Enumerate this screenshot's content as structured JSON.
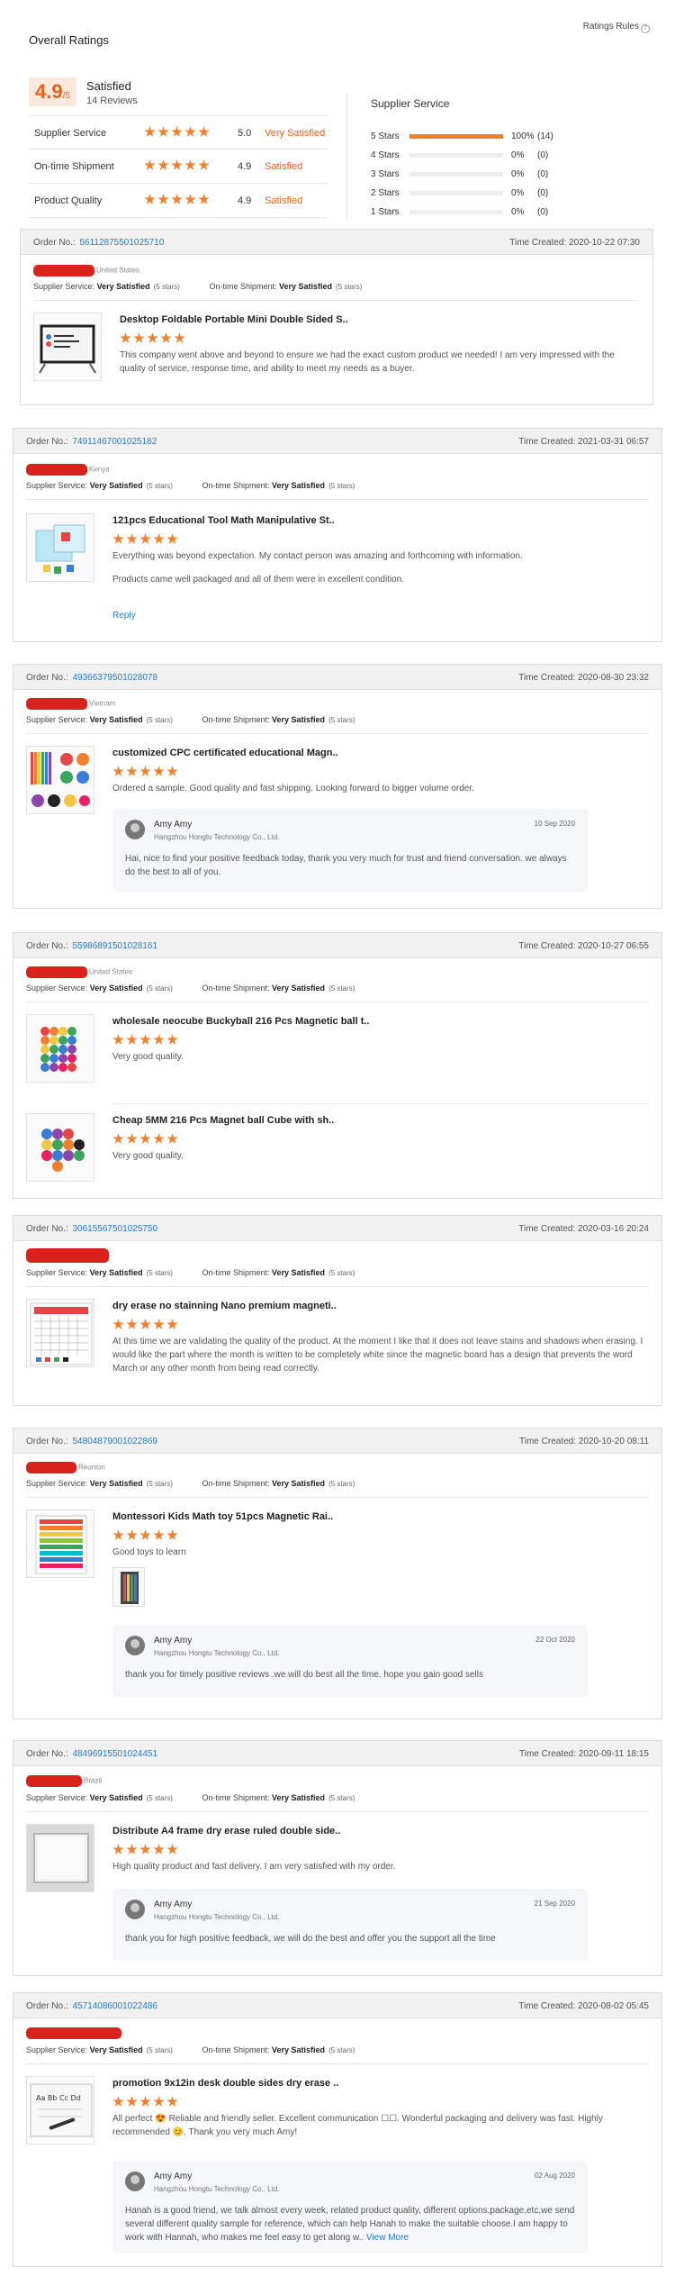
{
  "overall": {
    "title": "Overall Ratings",
    "rules": "Ratings Rules",
    "score_value": "4.9",
    "score_suffix": "/5",
    "score_label": "Satisfied",
    "reviews": "14 Reviews",
    "dimensions": [
      {
        "name": "Supplier Service",
        "value": "5.0",
        "label": "Very Satisfied"
      },
      {
        "name": "On-time Shipment",
        "value": "4.9",
        "label": "Satisfied"
      },
      {
        "name": "Product Quality",
        "value": "4.9",
        "label": "Satisfied"
      }
    ],
    "service_title": "Supplier Service",
    "distribution": [
      {
        "label": "5 Stars",
        "fraction": 1.0,
        "pct": "100%",
        "count": "(14)"
      },
      {
        "label": "4 Stars",
        "fraction": 0,
        "pct": "0%",
        "count": "(0)"
      },
      {
        "label": "3 Stars",
        "fraction": 0,
        "pct": "0%",
        "count": "(0)"
      },
      {
        "label": "2 Stars",
        "fraction": 0,
        "pct": "0%",
        "count": "(0)"
      },
      {
        "label": "1 Stars",
        "fraction": 0,
        "pct": "0%",
        "count": "(0)"
      }
    ]
  },
  "labels": {
    "order_no": "Order No.:",
    "time_created": "Time Created:",
    "supplier_service": "Supplier Service:",
    "ontime_shipment": "On-time Shipment:",
    "very_satisfied": "Very Satisfied",
    "five_stars": "(5 stars)",
    "reply": "Reply",
    "view_more": "View More"
  },
  "reviews": [
    {
      "order_no": "56112875501025710",
      "time": "2020-10-22 07:30",
      "country": "United States",
      "products": [
        {
          "title": "Desktop Foldable Portable Mini Double Sided S..",
          "text": "This company went above and beyond to ensure we had the exact custom product we needed! I am very impressed with the quality of service, response time, and ability to meet my needs as a buyer."
        }
      ]
    },
    {
      "order_no": "74911467001025182",
      "time": "2021-03-31 06:57",
      "country": "Kenya",
      "products": [
        {
          "title": "121pcs Educational Tool Math Manipulative St..",
          "text": "Everything was beyond expectation. My contact person was amazing and forthcoming with information.",
          "text2": "Products came well packaged and all of them were in excellent condition."
        }
      ]
    },
    {
      "order_no": "49366379501028078",
      "time": "2020-08-30 23:32",
      "country": "Vietnam",
      "products": [
        {
          "title": "customized CPC certificated educational Magn..",
          "text": "Ordered a sample. Good quality and fast shipping. Looking forward to bigger volume order."
        }
      ],
      "reply": {
        "name": "Amy Amy",
        "company": "Hangzhou Hongtu Technology Co., Ltd.",
        "date": "10 Sep 2020",
        "text": "Hai, nice to find your positive feedback today, thank you very much  for trust and friend conversation. we always do the best to all of you."
      }
    },
    {
      "order_no": "55986891501028161",
      "time": "2020-10-27 06:55",
      "country": "United States",
      "products": [
        {
          "title": "wholesale neocube Buckyball 216 Pcs Magnetic ball t..",
          "text": "Very good quality."
        },
        {
          "title": "Cheap 5MM 216 Pcs Magnet ball Cube with sh..",
          "text": "Very good quality."
        }
      ]
    },
    {
      "order_no": "30615567501025750",
      "time": "2020-03-16 20:24",
      "country": "",
      "products": [
        {
          "title": "dry erase no stainning Nano premium magneti..",
          "text": "At this time we are validating the quality of the product. At the moment I like that it does not leave stains and shadows when erasing. I would like the part where the month is written to be completely white since the magnetic board has a design that prevents the word March or any other month from being read correctly."
        }
      ]
    },
    {
      "order_no": "54804879001022869",
      "time": "2020-10-20 08:11",
      "country": "Reunion",
      "products": [
        {
          "title": "Montessori Kids Math toy 51pcs Magnetic Rai..",
          "text": "Good toys to learn"
        }
      ],
      "reply": {
        "name": "Amy Amy",
        "company": "Hangzhou Hongtu Technology Co., Ltd.",
        "date": "22 Oct 2020",
        "text": "thank you for timely positive reviews .we will do best all the time. hope you gain good sells"
      }
    },
    {
      "order_no": "48496915501024451",
      "time": "2020-09-11 18:15",
      "country": "Brazil",
      "products": [
        {
          "title": "Distribute A4 frame dry erase ruled double side..",
          "text": "High quality product and fast delivery. I am very satisfied with my order."
        }
      ],
      "reply": {
        "name": "Amy Amy",
        "company": "Hangzhou Hongtu Technology Co., Ltd.",
        "date": "21 Sep 2020",
        "text": "thank you for high positive feedback, we will do the best and offer you the support all the time"
      }
    },
    {
      "order_no": "45714086001022486",
      "time": "2020-08-02 05:45",
      "country": "",
      "products": [
        {
          "title": "promotion 9x12in desk double sides dry erase ..",
          "text": "All perfect 😍 Reliable and friendly seller. Excellent communication ☐☐. Wonderful packaging and delivery was fast. Highly recommended 😊. Thank you very much Amy!"
        }
      ],
      "reply": {
        "name": "Amy Amy",
        "company": "Hangzhou Hongtu Technology Co., Ltd.",
        "date": "02 Aug 2020",
        "text": "Hanah is a good friend, we talk almost every week, related product quality, different options,package,etc,we send several different quality sample for reference, which can help Hanah to make the suitable choose.I am happy to work with Hannah, who makes me feel easy to get along w.."
      }
    }
  ]
}
